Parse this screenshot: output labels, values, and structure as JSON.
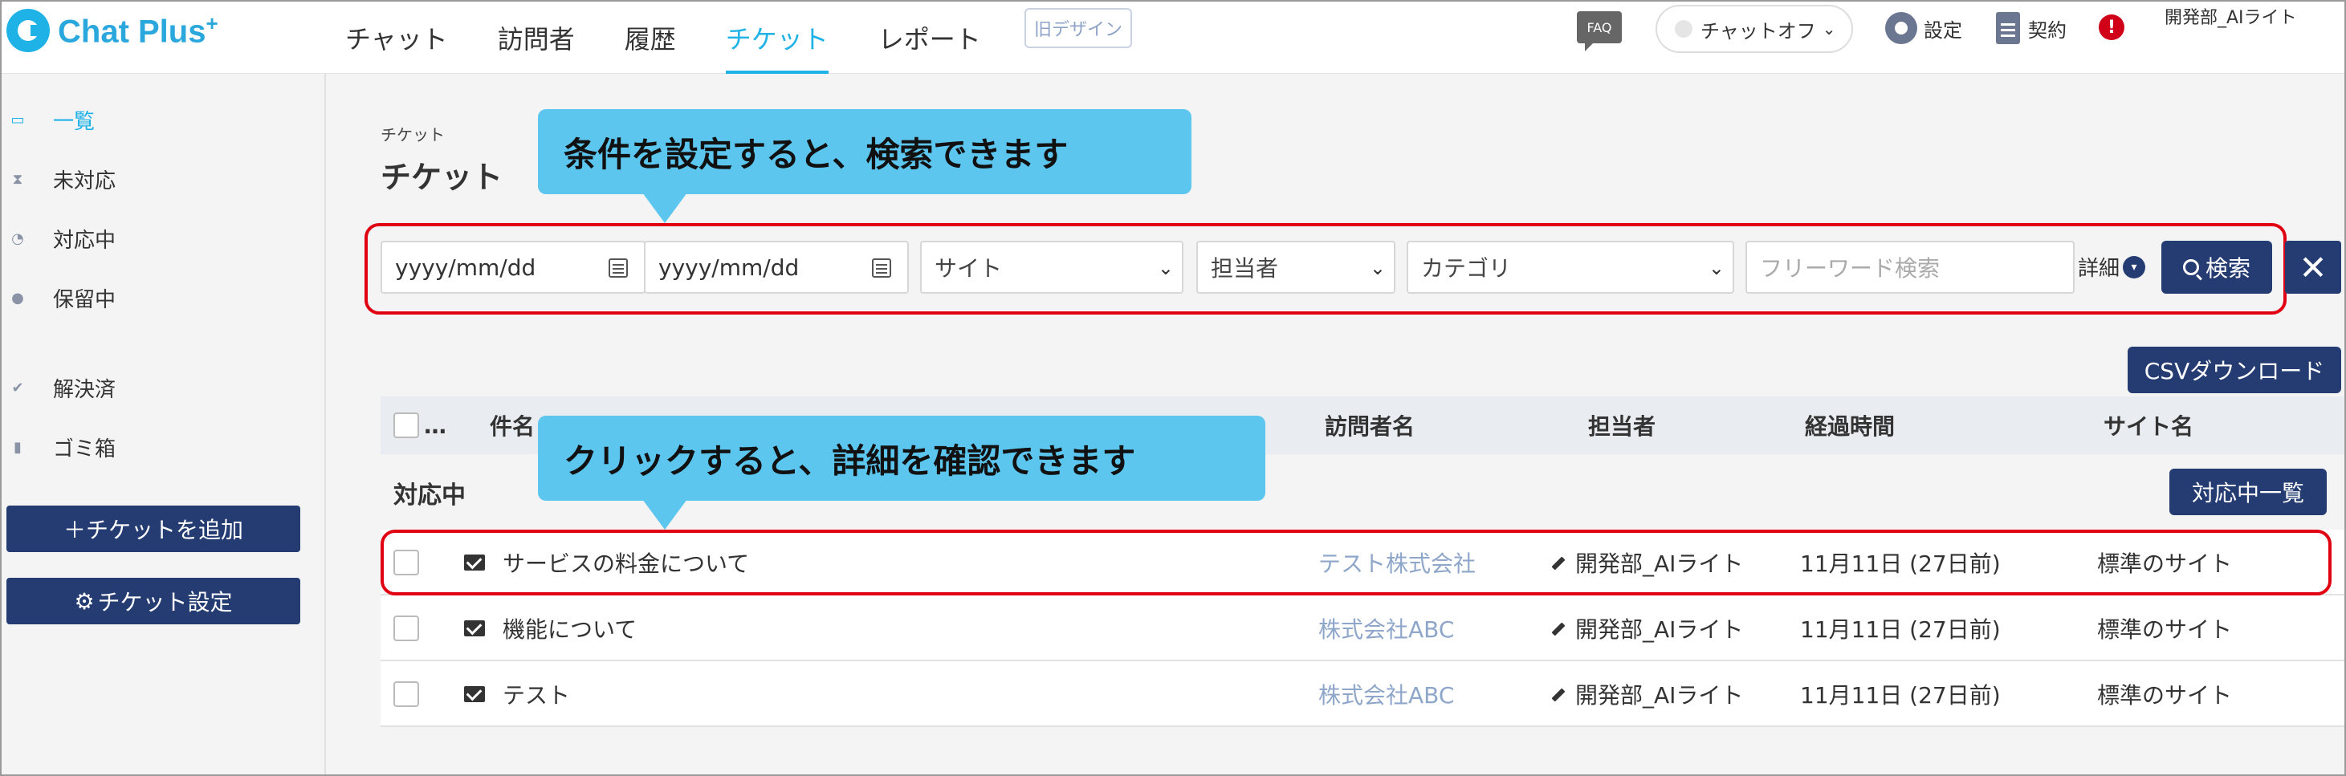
{
  "app": {
    "brand": "Chat Plus",
    "brand_sup": "+"
  },
  "nav": {
    "items": [
      {
        "label": "チャット"
      },
      {
        "label": "訪問者"
      },
      {
        "label": "履歴"
      },
      {
        "label": "チケット"
      },
      {
        "label": "レポート"
      }
    ],
    "active": "チケット",
    "old_design": "旧デザイン"
  },
  "header": {
    "faq": "FAQ",
    "chat_status": "チャットオフ",
    "settings": "設定",
    "contract": "契約",
    "alert": "!",
    "user": "開発部_AIライト"
  },
  "sidebar": {
    "items": [
      {
        "label": "一覧",
        "icon": "list-icon",
        "active": true
      },
      {
        "label": "未対応",
        "icon": "hourglass-icon"
      },
      {
        "label": "対応中",
        "icon": "in-progress-icon"
      },
      {
        "label": "保留中",
        "icon": "pending-icon"
      },
      {
        "label": "解決済",
        "icon": "check-icon"
      },
      {
        "label": "ゴミ箱",
        "icon": "trash-icon"
      }
    ],
    "add_ticket": "＋チケットを追加",
    "ticket_settings": "チケット設定"
  },
  "page": {
    "breadcrumb": "チケット",
    "title": "チケット"
  },
  "callouts": {
    "search": "条件を設定すると、検索できます",
    "click": "クリックすると、詳細を確認できます"
  },
  "filters": {
    "date_from": "yyyy/mm/dd",
    "date_to": "yyyy/mm/dd",
    "site": "サイト",
    "assignee": "担当者",
    "category": "カテゴリ",
    "keyword_placeholder": "フリーワード検索",
    "detail": "詳細",
    "search": "検索",
    "close": "✕"
  },
  "csv_download": "CSVダウンロード",
  "table": {
    "headers": {
      "more": "…",
      "subject": "件名",
      "visitor": "訪問者名",
      "assignee": "担当者",
      "elapsed": "経過時間",
      "site": "サイト名"
    },
    "group": {
      "title": "対応中",
      "button": "対応中一覧"
    },
    "rows": [
      {
        "subject": "サービスの料金について",
        "visitor": "テスト株式会社",
        "assignee": "開発部_AIライト",
        "elapsed": "11月11日 (27日前)",
        "site": "標準のサイト"
      },
      {
        "subject": "機能について",
        "visitor": "株式会社ABC",
        "assignee": "開発部_AIライト",
        "elapsed": "11月11日 (27日前)",
        "site": "標準のサイト"
      },
      {
        "subject": "テスト",
        "visitor": "株式会社ABC",
        "assignee": "開発部_AIライト",
        "elapsed": "11月11日 (27日前)",
        "site": "標準のサイト"
      }
    ]
  },
  "colors": {
    "accent": "#1fb2e6",
    "navy": "#243c72",
    "callout": "#5cc6ef",
    "highlight": "#e00012"
  }
}
